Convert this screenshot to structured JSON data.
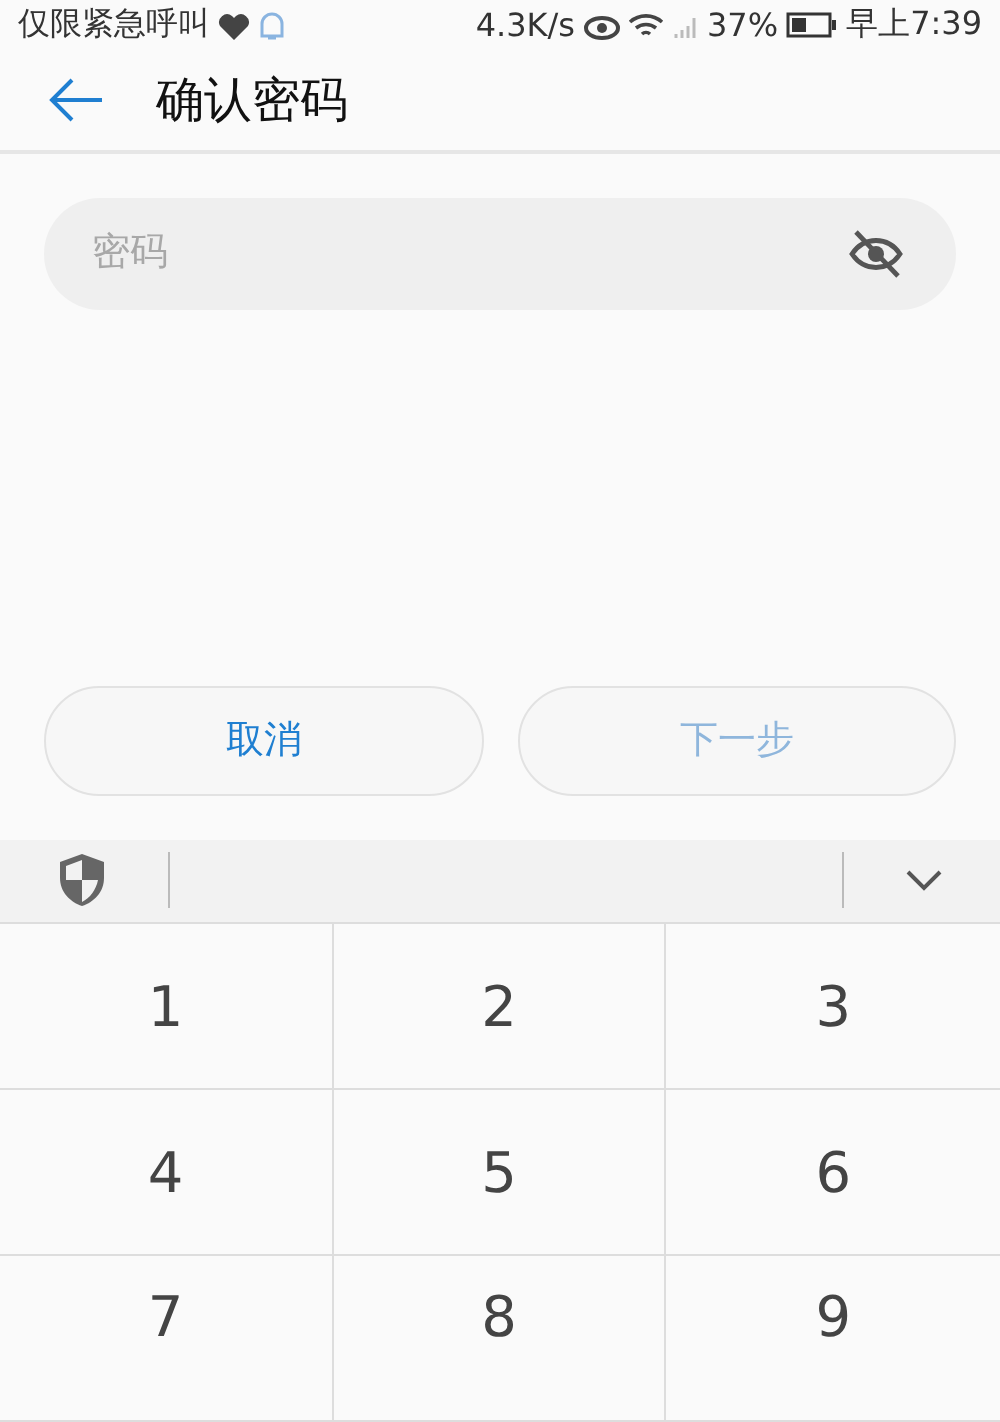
{
  "status_bar": {
    "carrier": "仅限紧急呼叫",
    "speed": "4.3K/s",
    "battery": "37%",
    "time": "早上7:39"
  },
  "header": {
    "title": "确认密码"
  },
  "password_field": {
    "placeholder": "密码"
  },
  "buttons": [
    {
      "label": "取消",
      "disabled": false
    },
    {
      "label": "下一步",
      "disabled": true
    }
  ],
  "keypad": [
    "1",
    "2",
    "3",
    "4",
    "5",
    "6",
    "7",
    "8",
    "9"
  ]
}
